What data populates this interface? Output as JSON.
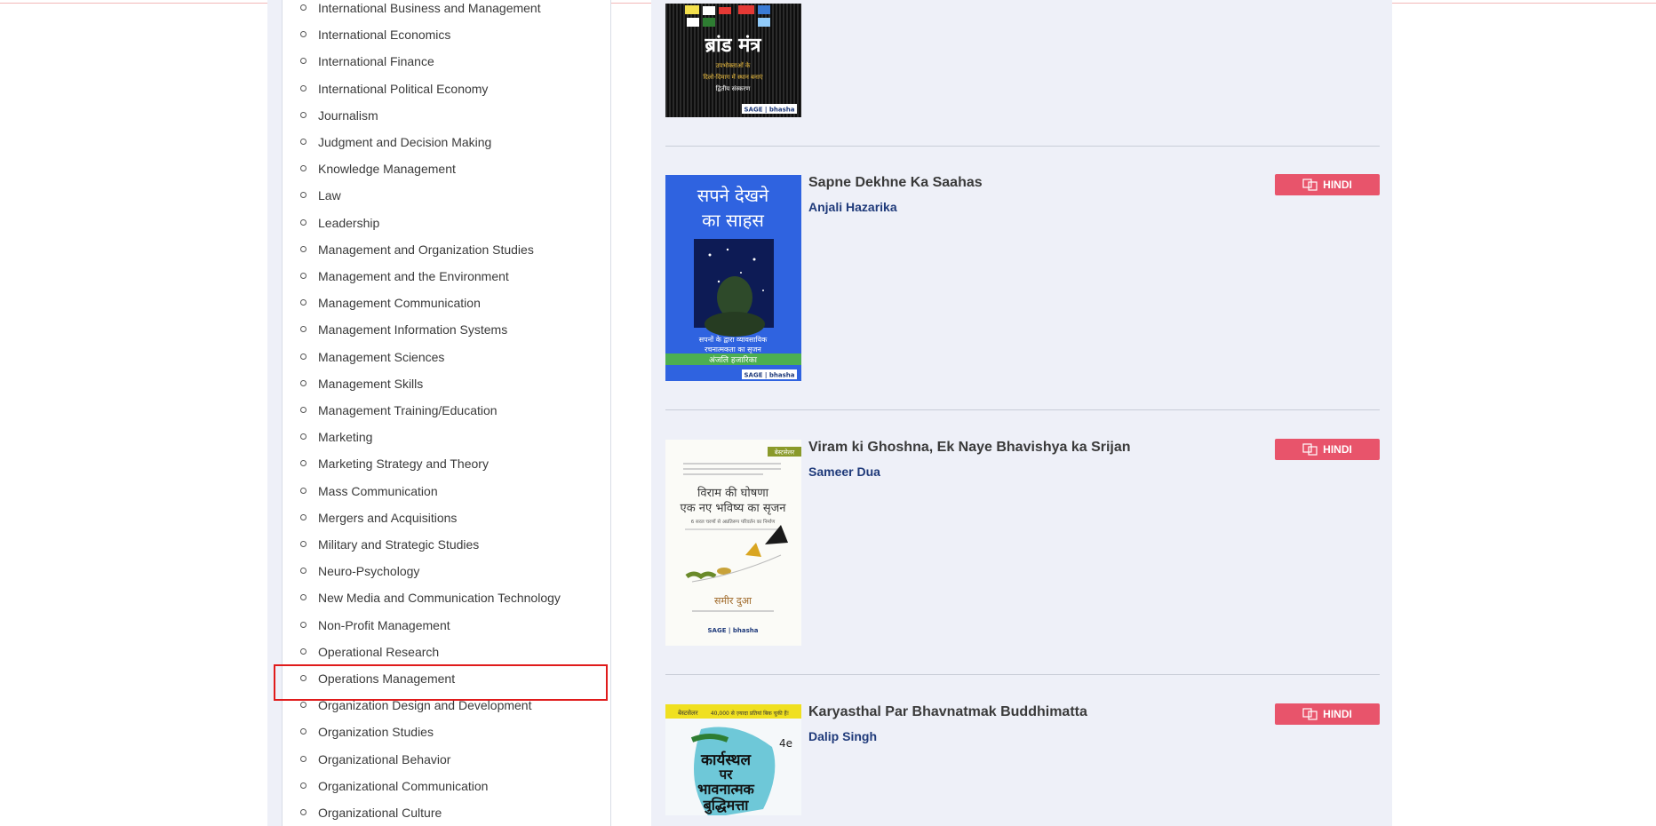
{
  "sidebar": {
    "categories": [
      "International Business and Management",
      "International Economics",
      "International Finance",
      "International Political Economy",
      "Journalism",
      "Judgment and Decision Making",
      "Knowledge Management",
      "Law",
      "Leadership",
      "Management and Organization Studies",
      "Management and the Environment",
      "Management Communication",
      "Management Information Systems",
      "Management Sciences",
      "Management Skills",
      "Management Training/Education",
      "Marketing",
      "Marketing Strategy and Theory",
      "Mass Communication",
      "Mergers and Acquisitions",
      "Military and Strategic Studies",
      "Neuro-Psychology",
      "New Media and Communication Technology",
      "Non-Profit Management",
      "Operational Research",
      "Operations Management",
      "Organization Design and Development",
      "Organization Studies",
      "Organizational Behavior",
      "Organizational Communication",
      "Organizational Culture"
    ],
    "highlighted": "Operations Management"
  },
  "books": [
    {
      "title": "",
      "author": "",
      "cover_text": [
        "ब्रांड मंत्र",
        "उपभोक्ताओं के",
        "दिलो-दिमाग में स्थान बनाएं",
        "द्वितीय संस्करण"
      ],
      "language": ""
    },
    {
      "title": "Sapne Dekhne Ka Saahas",
      "author": "Anjali Hazarika",
      "cover_text": [
        "सपने देखने",
        "का साहस",
        "सपनों के द्वारा व्यावसायिक",
        "रचनात्मकता का सृजन",
        "अंजलि हजारिका"
      ],
      "language": "HINDI"
    },
    {
      "title": "Viram ki Ghoshna, Ek Naye Bhavishya ka Srijan",
      "author": "Sameer Dua",
      "cover_text": [
        "बेस्टसेलर",
        "विराम की घोषणा",
        "एक नए भविष्य का सृजन",
        "6 सरल चरणों से अप्रतिरूप परिवर्तन का निर्माण",
        "समीर दुआ"
      ],
      "language": "HINDI"
    },
    {
      "title": "Karyasthal Par Bhavnatmak Buddhimatta",
      "author": "Dalip Singh",
      "cover_text": [
        "बेस्टसेलर",
        "40,000 से ज़्यादा प्रतियां बिक चुकी हैं!",
        "4e",
        "कार्यस्थल",
        "पर",
        "भावनात्मक",
        "बुद्धिमत्ता"
      ],
      "language": "HINDI"
    }
  ],
  "publisher_logo": "SAGE | bhasha",
  "colors": {
    "accent": "#e8546b",
    "author": "#1f3a7a",
    "highlight": "#e01b1b",
    "panel": "#eef0f8"
  }
}
